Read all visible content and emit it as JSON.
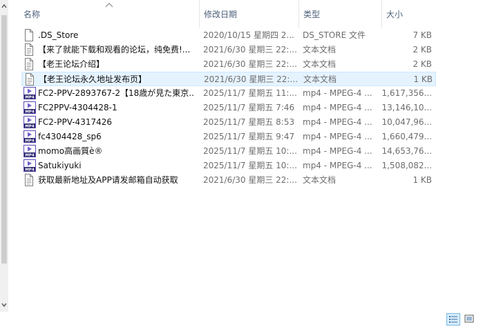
{
  "columns": {
    "name": "名称",
    "date": "修改日期",
    "type": "类型",
    "size": "大小"
  },
  "files": [
    {
      "icon": "generic-file-icon",
      "name": ".DS_Store",
      "date": "2020/10/15 星期四 2...",
      "type": "DS_STORE 文件",
      "size": "7 KB"
    },
    {
      "icon": "text-document-icon",
      "name": "【来了就能下载和观看的论坛，纯免费!...",
      "date": "2021/6/30 星期三 22:...",
      "type": "文本文档",
      "size": "2 KB"
    },
    {
      "icon": "text-document-icon",
      "name": "【老王论坛介绍】",
      "date": "2021/6/30 星期三 22:...",
      "type": "文本文档",
      "size": "2 KB"
    },
    {
      "icon": "text-document-icon",
      "name": "【老王论坛永久地址发布页】",
      "date": "2021/6/30 星期三 22:...",
      "type": "文本文档",
      "size": "1 KB"
    },
    {
      "icon": "mp4-video-icon",
      "name": "FC2-PPV-2893767-2【18歳が見た東京...",
      "date": "2025/11/7 星期五 11:...",
      "type": "mp4 - MPEG-4 ...",
      "size": "1,617,356..."
    },
    {
      "icon": "mp4-video-icon",
      "name": "FC2PPV-4304428-1",
      "date": "2025/11/7 星期五 7:46",
      "type": "mp4 - MPEG-4 ...",
      "size": "13,146,10..."
    },
    {
      "icon": "mp4-video-icon",
      "name": "FC2-PPV-4317426",
      "date": "2025/11/7 星期五 8:53",
      "type": "mp4 - MPEG-4 ...",
      "size": "10,047,96..."
    },
    {
      "icon": "mp4-video-icon",
      "name": "fc4304428_sp6",
      "date": "2025/11/7 星期五 9:47",
      "type": "mp4 - MPEG-4 ...",
      "size": "1,660,479..."
    },
    {
      "icon": "mp4-video-icon",
      "name": "momo高画質è®",
      "date": "2025/11/7 星期五 10:...",
      "type": "mp4 - MPEG-4 ...",
      "size": "14,653,76..."
    },
    {
      "icon": "mp4-video-icon",
      "name": "Satukiyuki",
      "date": "2025/11/7 星期五 10:...",
      "type": "mp4 - MPEG-4 ...",
      "size": "1,508,082..."
    },
    {
      "icon": "text-document-icon",
      "name": "获取最新地址及APP请发邮箱自动获取",
      "date": "2021/6/30 星期三 22:...",
      "type": "文本文档",
      "size": "1 KB"
    }
  ],
  "selected_index": 3,
  "mp4_label": "MP4",
  "colors": {
    "selection_bg": "#e5f3ff",
    "selection_border": "#cce8ff",
    "header_text": "#4c607a",
    "mp4_icon": "#5b4bb7"
  }
}
